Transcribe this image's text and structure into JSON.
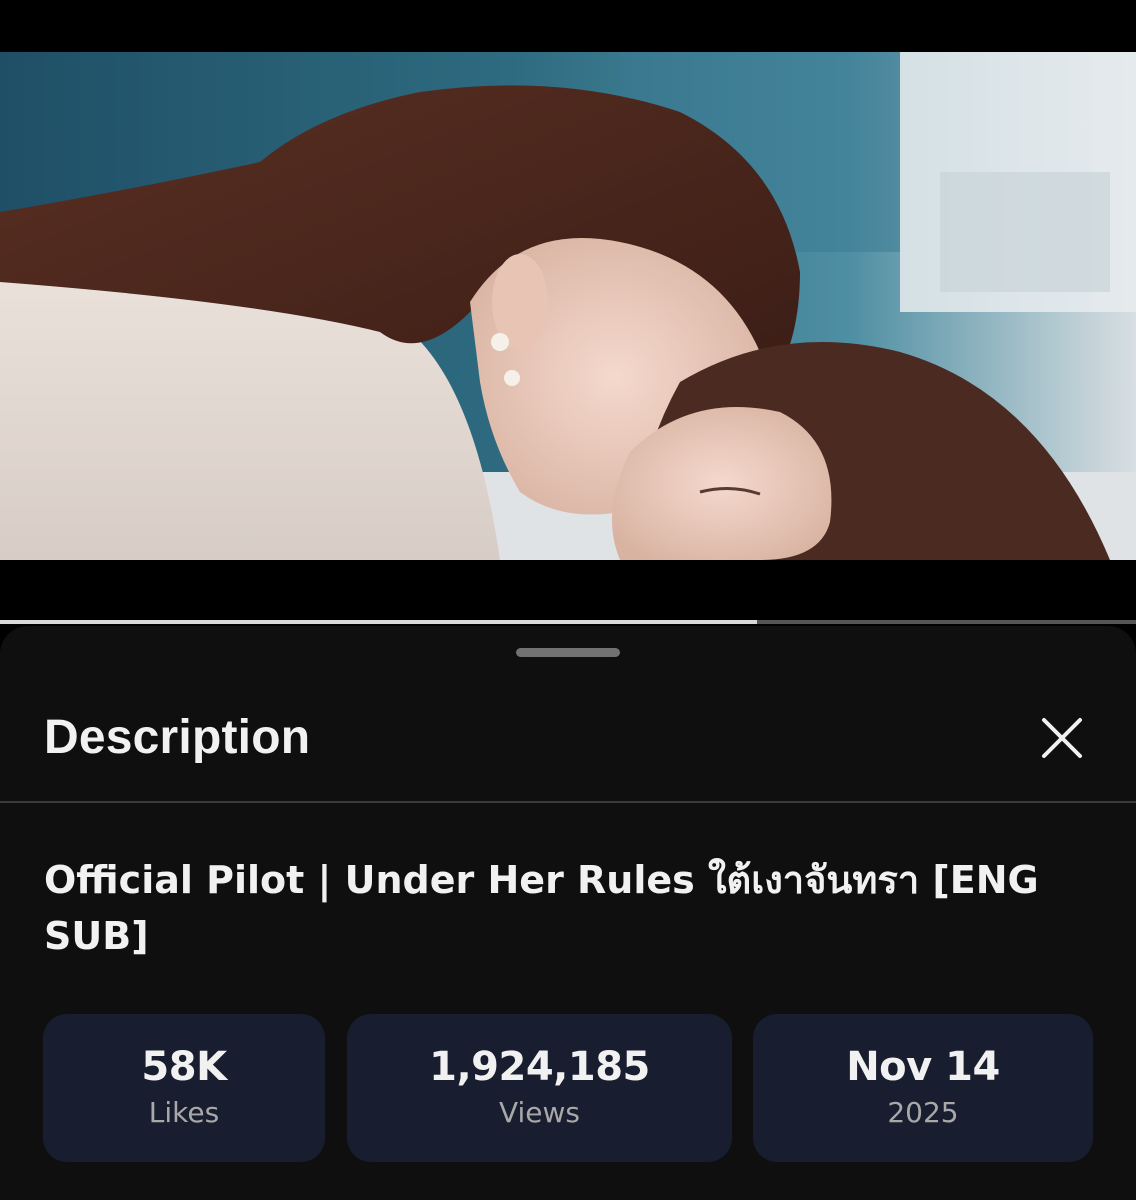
{
  "player": {
    "progress_fraction": 0.666,
    "buffered_fraction": 0.7
  },
  "sheet": {
    "title": "Description",
    "close_icon": "close-icon"
  },
  "video": {
    "title": "Official Pilot | Under Her Rules ใต้เงาจันทรา [ENG SUB]"
  },
  "stats": {
    "likes": {
      "value": "58K",
      "label": "Likes"
    },
    "views": {
      "value": "1,924,185",
      "label": "Views"
    },
    "date": {
      "value": "Nov 14",
      "label": "2025"
    }
  },
  "colors": {
    "sheet_background": "#0f0f0f",
    "card_background": "#181d2f",
    "primary_text": "#f1f1f1",
    "secondary_text": "#a8a8a8"
  }
}
